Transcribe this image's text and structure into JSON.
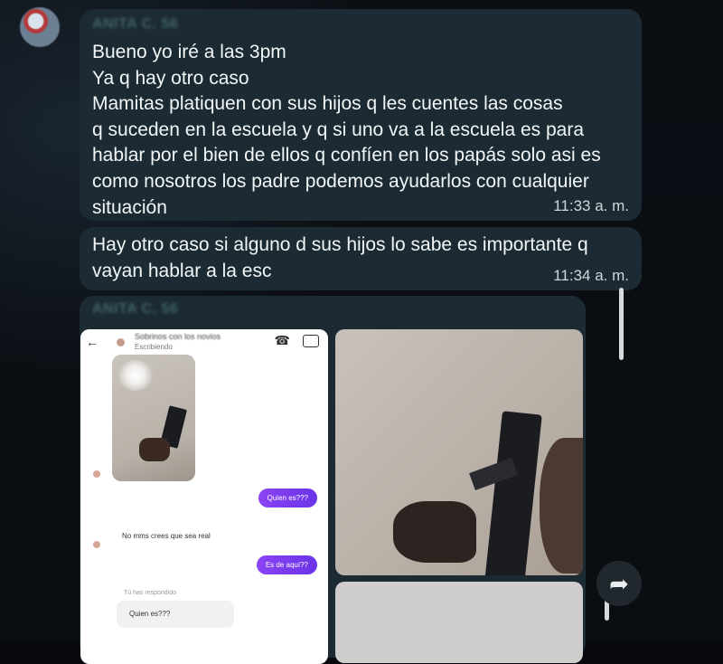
{
  "messages": [
    {
      "sender": "ANITA C. 56",
      "text": "Bueno yo iré a las 3pm\nYa q hay otro caso\nMamitas platiquen con sus hijos q les cuentes las cosas\nq suceden en la escuela y q si uno va a la escuela es para\nhablar por el bien de ellos q confíen en los papás solo asi es\ncomo nosotros los padre podemos ayudarlos con cualquier\nsituación",
      "time": "11:33 a. m."
    },
    {
      "text": "Hay otro caso si alguno d sus hijos lo sabe es importante q\nvayan hablar a la esc",
      "time": "11:34 a. m."
    }
  ],
  "forwarded": {
    "sender": "ANITA C. 56",
    "left_screenshot": {
      "contact_name": "Sobrinos con los novios",
      "status": "Escribiendo",
      "messages": [
        {
          "from": "me",
          "text": "Quien es???"
        },
        {
          "from": "them",
          "text": "No mms crees que sea real"
        },
        {
          "from": "me",
          "text": "Es de aquí??"
        }
      ],
      "reply_label": "Tú has respondido",
      "reply_text": "Quien es???"
    }
  },
  "icons": {
    "back": "back-arrow-icon",
    "call": "phone-icon",
    "video": "video-icon",
    "forward": "forward-icon"
  },
  "colors": {
    "background": "#07090c",
    "bubble": "#1c2b33",
    "pill": "#7b3cf0"
  }
}
